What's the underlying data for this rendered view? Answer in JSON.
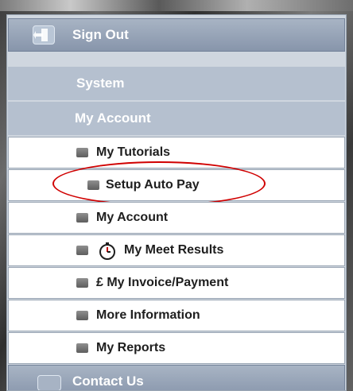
{
  "menu": {
    "sign_out": "Sign Out",
    "system": "System",
    "my_account_header": "My Account",
    "items": [
      {
        "label": "My Tutorials",
        "icon": "square-bullet-icon"
      },
      {
        "label": "Setup Auto Pay",
        "icon": "square-bullet-icon",
        "highlighted": true
      },
      {
        "label": "My Account",
        "icon": "square-bullet-icon"
      },
      {
        "label": "My Meet Results",
        "icon": "stopwatch-icon"
      },
      {
        "label": "£ My Invoice/Payment",
        "icon": "square-bullet-icon"
      },
      {
        "label": "More Information",
        "icon": "square-bullet-icon"
      },
      {
        "label": "My Reports",
        "icon": "square-bullet-icon"
      }
    ],
    "contact_us": "Contact Us"
  },
  "colors": {
    "highlight_ellipse": "#d00000",
    "header_bar": "#8795ab",
    "section_bg": "#b5c0cf"
  }
}
